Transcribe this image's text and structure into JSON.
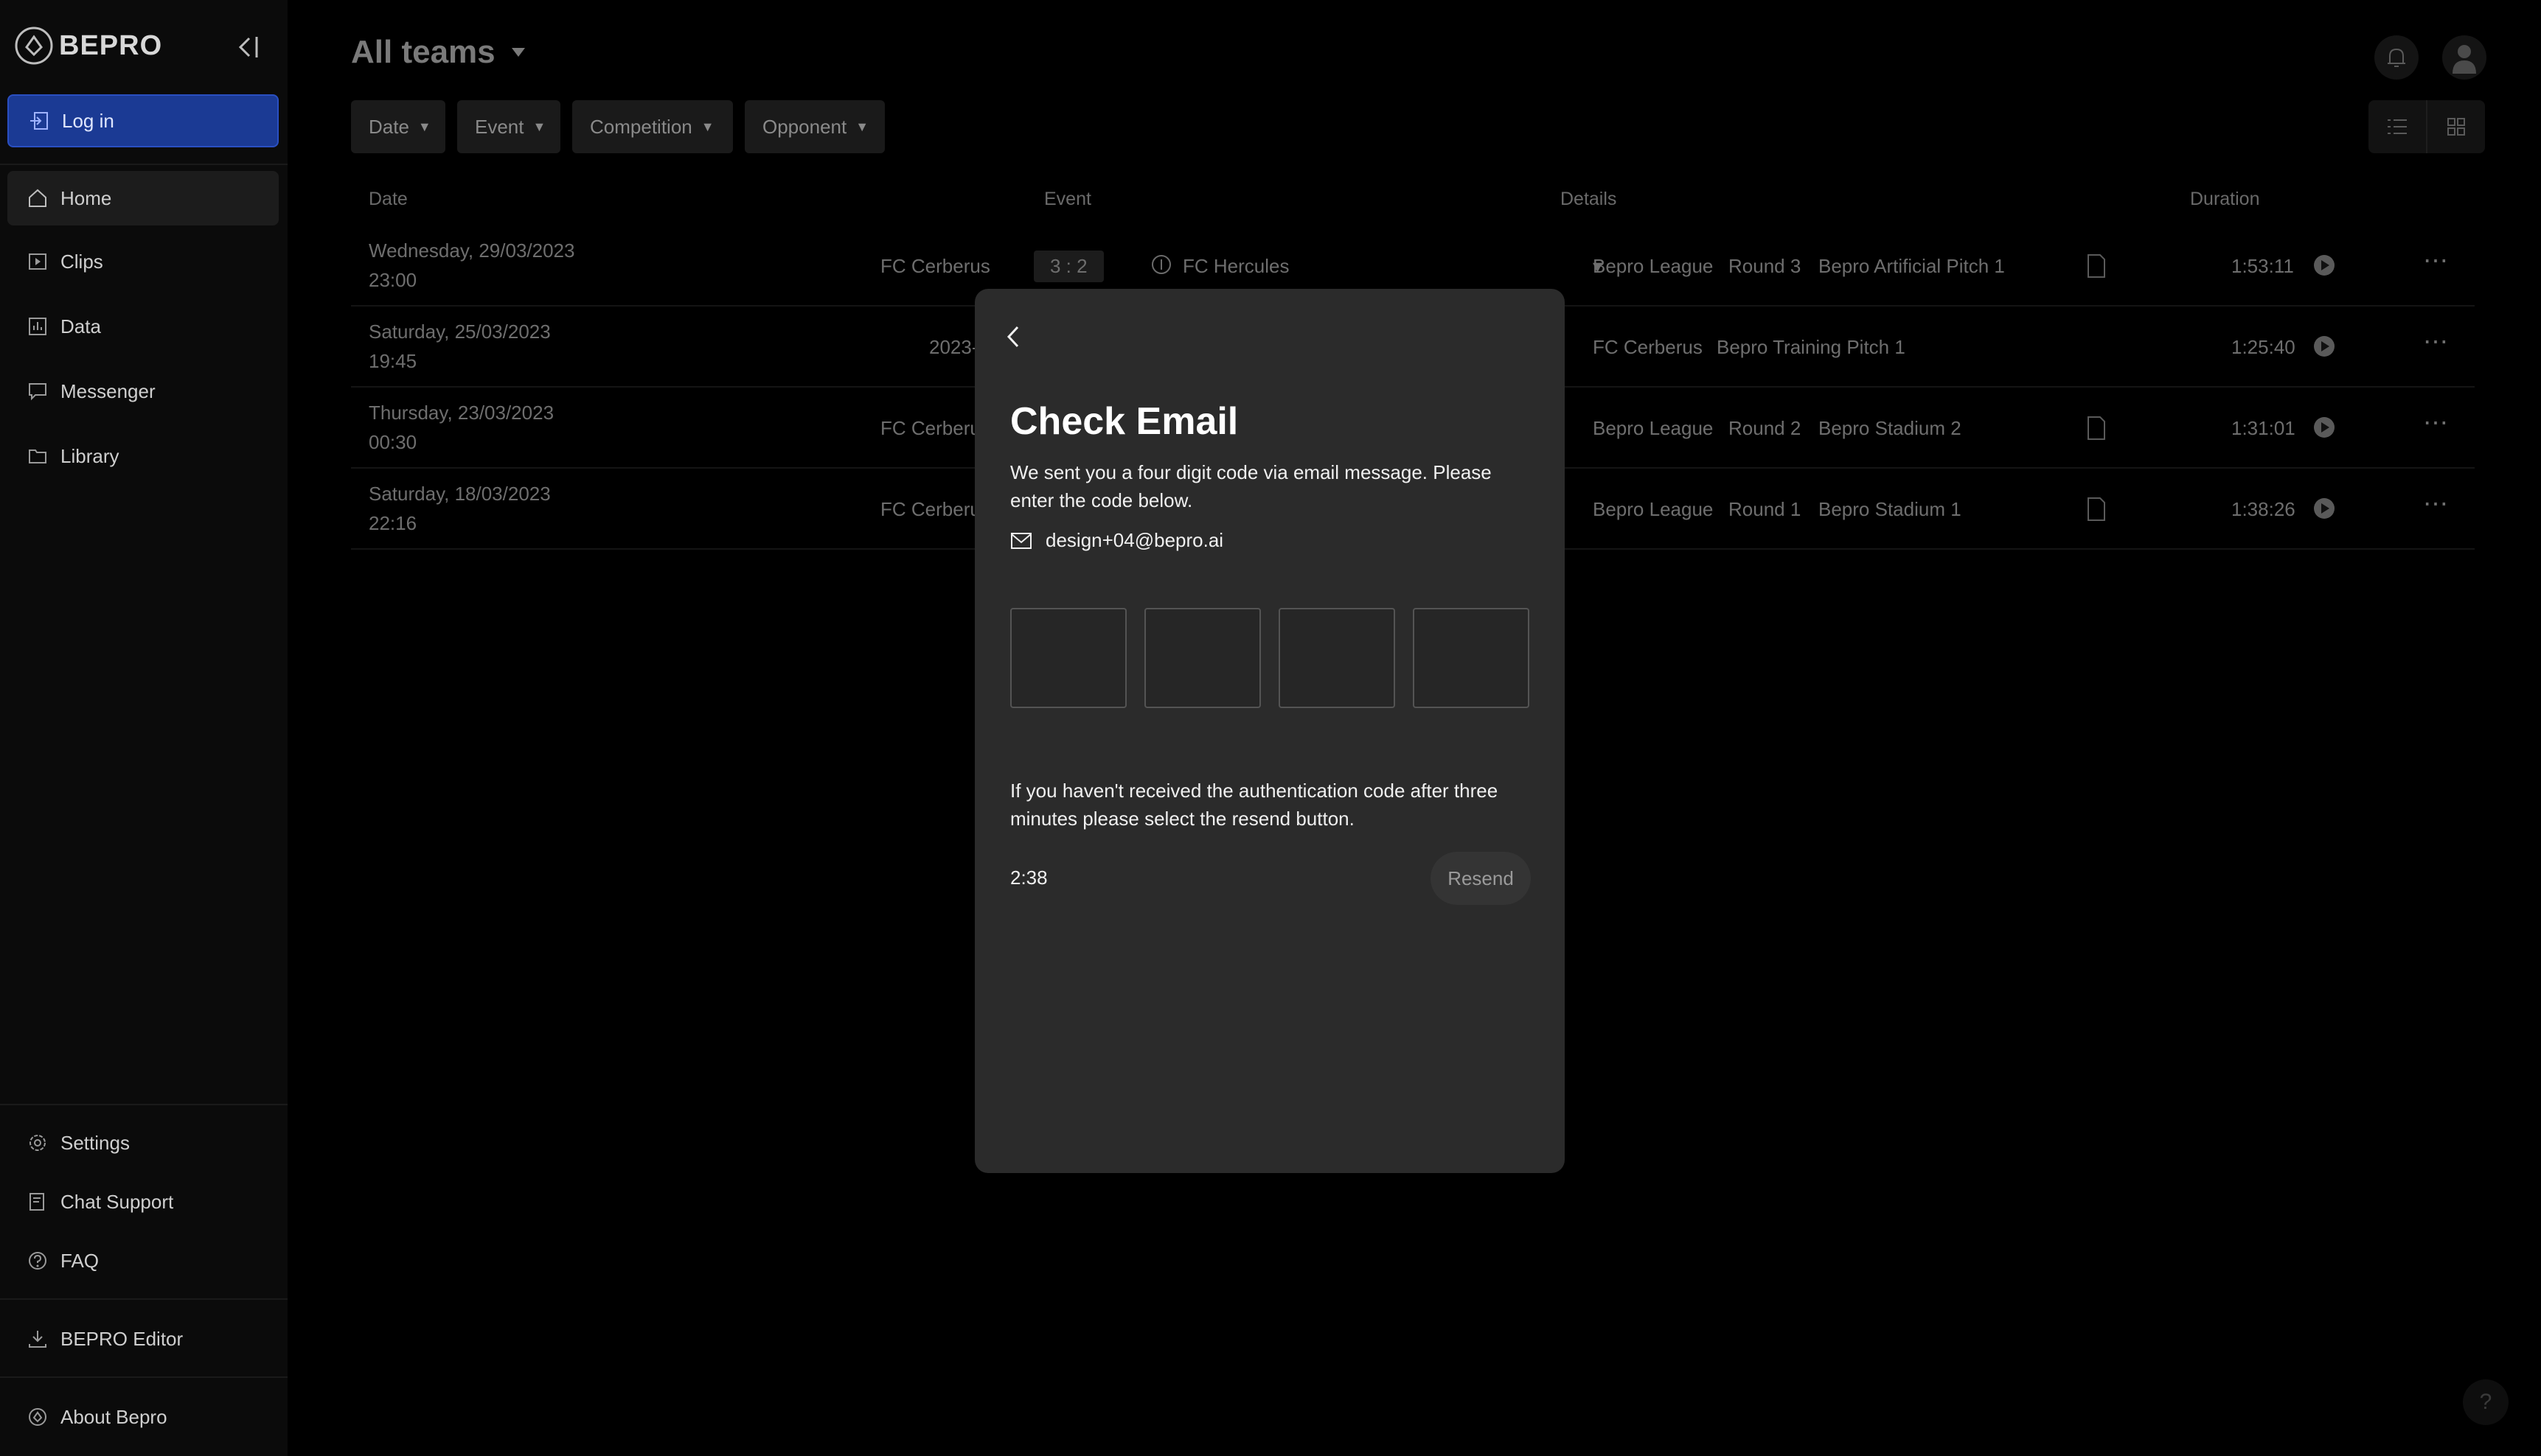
{
  "app": {
    "logo_text": "BEPRO"
  },
  "sidebar": {
    "login_label": "Log in",
    "items": [
      {
        "label": "Home",
        "icon": "home-icon"
      },
      {
        "label": "Clips",
        "icon": "clips-icon"
      },
      {
        "label": "Data",
        "icon": "chart-icon"
      },
      {
        "label": "Messenger",
        "icon": "chat-icon"
      },
      {
        "label": "Library",
        "icon": "folder-icon"
      }
    ],
    "bottom_items": [
      {
        "label": "Settings",
        "icon": "gear-icon"
      },
      {
        "label": "Chat Support",
        "icon": "support-icon"
      },
      {
        "label": "FAQ",
        "icon": "question-icon"
      },
      {
        "label": "BEPRO Editor",
        "icon": "download-icon"
      },
      {
        "label": "About Bepro",
        "icon": "bepro-icon"
      }
    ]
  },
  "header": {
    "title": "All teams"
  },
  "filters": [
    "Date",
    "Event",
    "Competition",
    "Opponent"
  ],
  "table": {
    "columns": [
      "Date",
      "Event",
      "Details",
      "Duration"
    ],
    "rows": [
      {
        "date": "Wednesday, 29/03/2023",
        "time": "23:00",
        "home": "FC Cerberus",
        "score": "3 : 2",
        "away": "FC Hercules",
        "details": [
          "Bepro League",
          "Round 3",
          "Bepro Artificial Pitch 1"
        ],
        "duration": "1:53:11"
      },
      {
        "date": "Saturday, 25/03/2023",
        "time": "19:45",
        "home": "2023-",
        "score": "",
        "away": "",
        "details": [
          "FC Cerberus",
          "Bepro Training Pitch 1"
        ],
        "duration": "1:25:40"
      },
      {
        "date": "Thursday, 23/03/2023",
        "time": "00:30",
        "home": "FC Cerberu",
        "score": "",
        "away": "",
        "details": [
          "Bepro League",
          "Round 2",
          "Bepro Stadium 2"
        ],
        "duration": "1:31:01"
      },
      {
        "date": "Saturday, 18/03/2023",
        "time": "22:16",
        "home": "FC Cerberu",
        "score": "",
        "away": "",
        "details": [
          "Bepro League",
          "Round 1",
          "Bepro Stadium 1"
        ],
        "duration": "1:38:26"
      }
    ]
  },
  "modal": {
    "title": "Check Email",
    "description": "We sent you a four digit code via email message. Please enter the code below.",
    "email": "design+04@bepro.ai",
    "code_digits": [
      "",
      "",
      "",
      ""
    ],
    "resend_note": "If you haven't received the authentication code after three minutes please select the resend button.",
    "timer": "2:38",
    "resend_label": "Resend"
  },
  "help_label": "?"
}
